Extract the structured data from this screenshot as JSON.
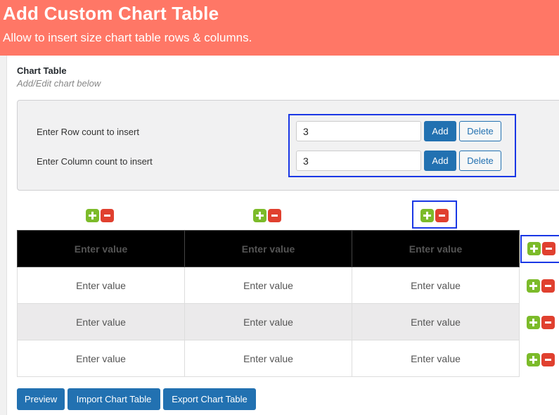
{
  "header": {
    "title": "Add Custom Chart Table",
    "subtitle": "Allow to insert size chart table rows & columns."
  },
  "section": {
    "title": "Chart Table",
    "subtitle": "Add/Edit chart below"
  },
  "insert": {
    "row_label": "Enter Row count to insert",
    "row_value": "3",
    "column_label": "Enter Column count to insert",
    "column_value": "3",
    "add_label": "Add",
    "delete_label": "Delete"
  },
  "icons": {
    "plus": "plus-icon",
    "minus": "minus-icon"
  },
  "table": {
    "placeholder": "Enter value",
    "rows": [
      [
        "Enter value",
        "Enter value",
        "Enter value"
      ],
      [
        "Enter value",
        "Enter value",
        "Enter value"
      ],
      [
        "Enter value",
        "Enter value",
        "Enter value"
      ],
      [
        "Enter value",
        "Enter value",
        "Enter value"
      ]
    ]
  },
  "footer": {
    "preview_label": "Preview",
    "import_label": "Import Chart Table",
    "export_label": "Export Chart Table"
  },
  "colors": {
    "header_bg": "#ff7766",
    "primary": "#2271b1",
    "add_icon": "#7cbb2a",
    "remove_icon": "#e0402f",
    "highlight": "#1a37e5"
  }
}
